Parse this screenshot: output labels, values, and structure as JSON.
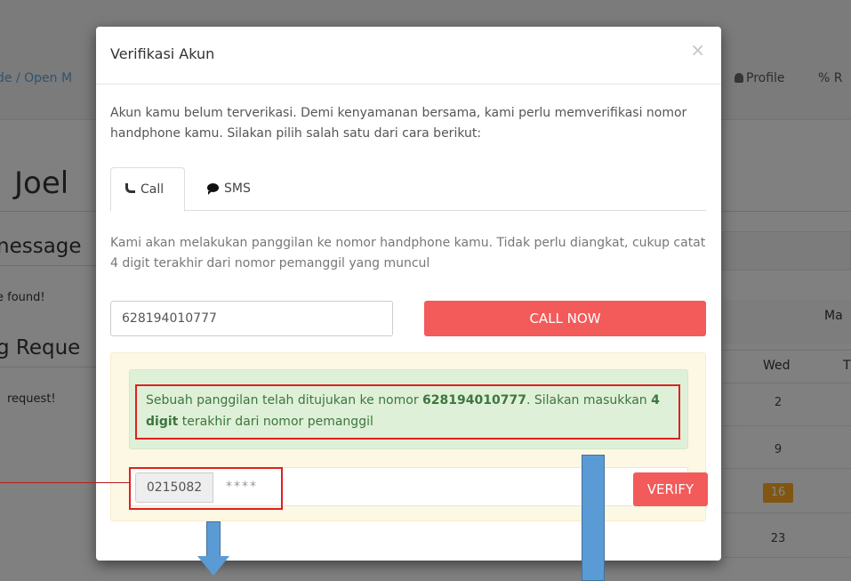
{
  "background": {
    "breadcrumb": "de / Open M",
    "nav_profile": "Profile",
    "nav_r": "R",
    "title": "Joel",
    "heading_message": "nessage",
    "found_text": "e found!",
    "heading_request": "g Reque",
    "request_text": "request!",
    "calendar": {
      "month": "Ma",
      "day_wed": "Wed",
      "day_next": "T",
      "dates": [
        "2",
        "9",
        "16",
        "23"
      ],
      "today": "16"
    }
  },
  "modal": {
    "title": "Verifikasi Akun",
    "close": "×",
    "intro": "Akun kamu belum terverikasi. Demi kenyamanan bersama, kami perlu memverifikasi nomor handphone kamu. Silakan pilih salah satu dari cara berikut:",
    "tabs": [
      {
        "label": "Call",
        "icon": "phone-icon",
        "active": true
      },
      {
        "label": "SMS",
        "icon": "comment-icon",
        "active": false
      }
    ],
    "description": "Kami akan melakukan panggilan ke nomor handphone kamu. Tidak perlu diangkat, cukup catat 4 digit terakhir dari nomor pemanggil yang muncul",
    "phone_value": "628194010777",
    "call_button": "CALL NOW",
    "alert": {
      "part1": "Sebuah panggilan telah ditujukan ke nomor ",
      "number": "628194010777",
      "part2": ". Silakan masukkan ",
      "bold_digits": "4 digit",
      "part3": " terakhir dari nomor pemanggil"
    },
    "code_prefix": "0215082",
    "code_placeholder": "****",
    "verify_button": "VERIFY"
  },
  "colors": {
    "accent_red": "#f35a5a",
    "alert_green_bg": "#dff0d8",
    "alert_green_text": "#3c763d",
    "warning_bg": "#fcf8e3",
    "annotation_red": "#e02020",
    "annotation_arrow": "#5b9bd5"
  }
}
